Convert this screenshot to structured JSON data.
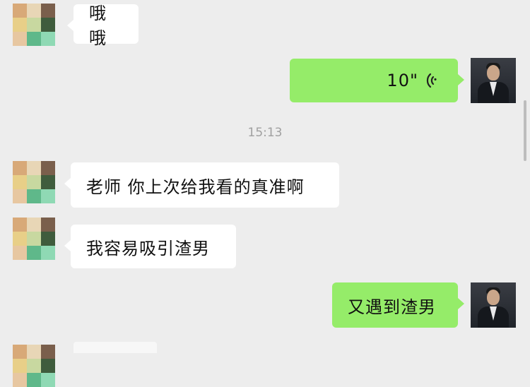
{
  "messages": [
    {
      "side": "left",
      "text": "哦哦"
    },
    {
      "side": "right",
      "type": "voice",
      "duration": "10\""
    },
    {
      "side": "left",
      "text": "老师 你上次给我看的真准啊"
    },
    {
      "side": "left",
      "text": "我容易吸引渣男"
    },
    {
      "side": "right",
      "text": "又遇到渣男"
    }
  ],
  "timestamp": "15:13",
  "colors": {
    "background": "#ededed",
    "bubble_incoming": "#ffffff",
    "bubble_outgoing": "#95ec69",
    "timestamp_text": "#a0a0a0"
  },
  "icons": {
    "voice": "voice-wave-icon",
    "contact_avatar": "mosaic-avatar",
    "self_avatar": "man-in-suit-avatar"
  }
}
